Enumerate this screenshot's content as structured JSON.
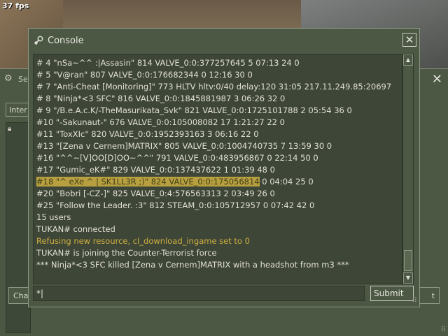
{
  "hud": {
    "fps": "37 fps"
  },
  "background_window": {
    "title": "Se",
    "tab_label": "Inter",
    "left_button_label": "Cha",
    "right_button_label": "t",
    "icons": {
      "title": "steam-icon",
      "close": "close-icon",
      "lock": "lock-icon"
    }
  },
  "console": {
    "title": "Console",
    "icons": {
      "title": "steam-icon",
      "close": "close-icon"
    },
    "lines": [
      {
        "text": "# 4 \"nSa~^^ :|Assasin\" 814 VALVE_0:0:377257645   5 07:13   24    0",
        "kind": "normal"
      },
      {
        "text": "# 5  \"V@ran\" 807 VALVE_0:0:176682344   0 12:16   30    0",
        "kind": "normal"
      },
      {
        "text": "# 7 \"Anti-Cheat [Monitoring]\" 773 HLTV hltv:0/40 delay:120 31:05 217.11.249.85:20697",
        "kind": "normal"
      },
      {
        "text": "# 8 \"Ninja*<3 SFC\" 816 VALVE_0:0:1845881987   3 06:26   32    0",
        "kind": "normal"
      },
      {
        "text": "# 9 \"/B.e.A.c.K/-TheMasurikata_Svk\" 821 VALVE_0:0:1725101788   2 05:54   36    0",
        "kind": "normal"
      },
      {
        "text": "#10 \"-Sakunaut-\" 676 VALVE_0:0:105008082  17  1:21:27   22    0",
        "kind": "normal"
      },
      {
        "text": "#11 \"ToxXIc\" 820 VALVE_0:0:1952393163   3 06:16   22    0",
        "kind": "normal"
      },
      {
        "text": "#13 \"[Zena v Cernem]MATRIX\" 805 VALVE_0:0:1004740735   7 13:59   30    0",
        "kind": "normal"
      },
      {
        "text": "#16 \"^^~[V]OO[D]OO~^^\" 791 VALVE_0:0:483956867   0 22:14   50    0",
        "kind": "normal"
      },
      {
        "text": "#17 \"Gumic_eK#\" 829 VALVE_0:0:137437622   1 01:39   48    0",
        "kind": "normal"
      },
      {
        "text_highlighted": "#18 \"^ eXe ^ | SK1LL3R ;)\" 824 VALVE_0:0:175056814",
        "text_rest": " 0 04:04   25    0",
        "kind": "selected"
      },
      {
        "text": "#20 \"Bobri [-CZ-]\" 825 VALVE_0:4:576563313   2 03:49   26    0",
        "kind": "normal"
      },
      {
        "text": "#25 \"Follow the Leader. :3\" 812 STEAM_0:0:105712957   0 07:42   42    0",
        "kind": "normal"
      },
      {
        "text": "15 users",
        "kind": "normal"
      },
      {
        "text": "TUKAN# connected",
        "kind": "normal"
      },
      {
        "text": "Refusing new resource, cl_download_ingame set to 0",
        "kind": "warn"
      },
      {
        "text": "TUKAN# is joining the Counter-Terrorist force",
        "kind": "normal"
      },
      {
        "text": "*** Ninja*<3 SFC killed [Zena v Cernem]MATRIX with a headshot from m3 ***",
        "kind": "normal"
      }
    ],
    "input_value": "*|",
    "submit_label": "Submit",
    "colors": {
      "normal": "#e0e0d4",
      "warn": "#d0b040",
      "highlight_bg": "#b8a040"
    }
  }
}
